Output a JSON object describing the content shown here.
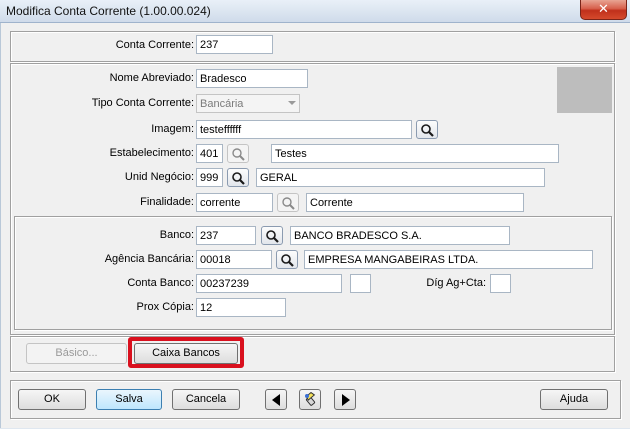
{
  "window": {
    "title": "Modifica Conta Corrente (1.00.00.024)",
    "close_glyph": "✕"
  },
  "form": {
    "conta_corrente": {
      "label": "Conta Corrente:",
      "value": "237"
    },
    "nome_abreviado": {
      "label": "Nome Abreviado:",
      "value": "Bradesco"
    },
    "tipo_conta": {
      "label": "Tipo Conta Corrente:",
      "value": "Bancária"
    },
    "imagem": {
      "label": "Imagem:",
      "value": "testeffffff"
    },
    "estabelecimento": {
      "label": "Estabelecimento:",
      "code": "401",
      "description": "Testes"
    },
    "unid_negocio": {
      "label": "Unid Negócio:",
      "code": "999",
      "description": "GERAL"
    },
    "finalidade": {
      "label": "Finalidade:",
      "code": "corrente",
      "description": "Corrente"
    },
    "banco": {
      "label": "Banco:",
      "code": "237",
      "description": "BANCO BRADESCO S.A."
    },
    "agencia": {
      "label": "Agência Bancária:",
      "code": "00018",
      "description": "EMPRESA MANGABEIRAS LTDA."
    },
    "conta_banco": {
      "label": "Conta Banco:",
      "value": "00237239",
      "digit": ""
    },
    "dig_ag_cta": {
      "label": "Díg Ag+Cta:",
      "value": ""
    },
    "prox_copia": {
      "label": "Prox Cópia:",
      "value": "12"
    }
  },
  "tabs_buttons": {
    "basico": "Básico...",
    "caixa_bancos": "Caixa Bancos"
  },
  "footer": {
    "ok": "OK",
    "salva": "Salva",
    "cancela": "Cancela",
    "ajuda": "Ajuda"
  },
  "icons": {
    "lookup": "magnifier-icon",
    "lookup_disabled": "magnifier-disabled-icon",
    "nav_prev": "arrow-left-icon",
    "nav_search": "flashlight-icon",
    "nav_next": "arrow-right-icon"
  },
  "colors": {
    "highlight": "#d9101e",
    "primary_button": "#bee6fd",
    "photo_placeholder": "#bdbdbd"
  }
}
